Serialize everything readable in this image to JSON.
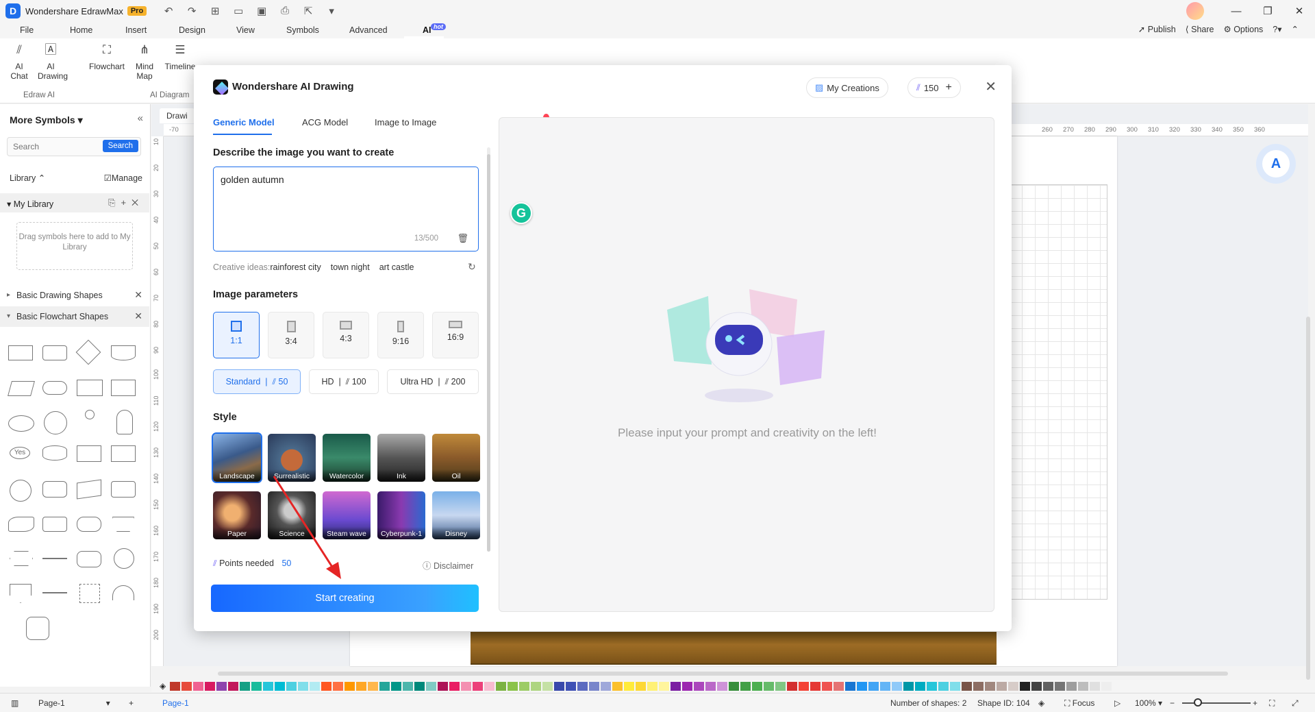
{
  "titlebar": {
    "app_title": "Wondershare EdrawMax",
    "badge": "Pro"
  },
  "menu": {
    "items": [
      "File",
      "Home",
      "Insert",
      "Design",
      "View",
      "Symbols",
      "Advanced",
      "AI"
    ],
    "hot_badge": "hot",
    "publish": "Publish",
    "share": "Share",
    "options": "Options"
  },
  "ribbon": {
    "ai_chat": "AI Chat",
    "ai_drawing": "AI Drawing",
    "flowchart": "Flowchart",
    "mind_map": "Mind Map",
    "timeline": "Timeline",
    "group_edraw_ai": "Edraw AI",
    "group_ai_diagram": "AI Diagram"
  },
  "left_panel": {
    "title": "More Symbols",
    "search_placeholder": "Search",
    "search_button": "Search",
    "library_label": "Library",
    "manage_label": "Manage",
    "my_library": "My Library",
    "drop_hint": "Drag symbols here to add to My Library",
    "categories": [
      "Basic Drawing Shapes",
      "Basic Flowchart Shapes"
    ],
    "yes_label": "Yes"
  },
  "canvas": {
    "doc_tab": "Drawi",
    "ruler_top": [
      "-70",
      "260",
      "270",
      "280",
      "290",
      "300",
      "310",
      "320",
      "330",
      "340",
      "350",
      "360"
    ],
    "ruler_left": [
      "10",
      "20",
      "30",
      "40",
      "50",
      "60",
      "70",
      "80",
      "90",
      "100",
      "110",
      "120",
      "130",
      "140",
      "150",
      "160",
      "170",
      "180",
      "190",
      "200"
    ]
  },
  "modal": {
    "title": "Wondershare AI Drawing",
    "my_creations": "My Creations",
    "points_balance": "150",
    "tabs": [
      "Generic Model",
      "ACG Model",
      "Image to Image"
    ],
    "describe_label": "Describe the image you want to create",
    "prompt_value": "golden autumn",
    "counter": "13/500",
    "ideas_label": "Creative ideas:",
    "ideas": [
      "rainforest city",
      "town night",
      "art castle"
    ],
    "params_label": "Image parameters",
    "ratios": [
      "1:1",
      "3:4",
      "4:3",
      "9:16",
      "16:9"
    ],
    "qualities": [
      {
        "name": "Standard",
        "cost": "50"
      },
      {
        "name": "HD",
        "cost": "100"
      },
      {
        "name": "Ultra HD",
        "cost": "200"
      }
    ],
    "style_label": "Style",
    "styles": [
      "Landscape",
      "Surrealistic",
      "Watercolor",
      "Ink",
      "Oil",
      "Paper",
      "Science",
      "Steam wave",
      "Cyberpunk-1",
      "Disney"
    ],
    "points_needed_label": "Points needed",
    "points_needed_value": "50",
    "disclaimer": "Disclaimer",
    "start_button": "Start creating",
    "preview_placeholder": "Please input your prompt and creativity on the left!"
  },
  "status": {
    "page_select": "Page-1",
    "page_tab": "Page-1",
    "shape_count": "Number of shapes: 2",
    "shape_id": "Shape ID: 104",
    "focus": "Focus",
    "zoom": "100%"
  },
  "palette": [
    "#c0392b",
    "#e74c3c",
    "#f06292",
    "#d81b60",
    "#8e44ad",
    "#c2185b",
    "#16a085",
    "#1abc9c",
    "#26c6da",
    "#00bcd4",
    "#4dd0e1",
    "#80deea",
    "#b2ebf2",
    "#ff5722",
    "#ff7043",
    "#ff9800",
    "#ffa726",
    "#ffb74d",
    "#26a69a",
    "#009688",
    "#4db6ac",
    "#00897b",
    "#80cbc4",
    "#ad1457",
    "#e91e63",
    "#f48fb1",
    "#ec407a",
    "#f8bbd0",
    "#7cb342",
    "#8bc34a",
    "#9ccc65",
    "#aed581",
    "#c5e1a5",
    "#3949ab",
    "#3f51b5",
    "#5c6bc0",
    "#7986cb",
    "#9fa8da",
    "#fbc02d",
    "#ffeb3b",
    "#fdd835",
    "#fff176",
    "#fff59d",
    "#7b1fa2",
    "#9c27b0",
    "#ab47bc",
    "#ba68c8",
    "#ce93d8",
    "#388e3c",
    "#43a047",
    "#4caf50",
    "#66bb6a",
    "#81c784",
    "#d32f2f",
    "#f44336",
    "#e53935",
    "#ef5350",
    "#e57373",
    "#1976d2",
    "#2196f3",
    "#42a5f5",
    "#64b5f6",
    "#90caf9",
    "#0097a7",
    "#00acc1",
    "#26c6da",
    "#4dd0e1",
    "#80deea",
    "#795548",
    "#8d6e63",
    "#a1887f",
    "#bcaaa4",
    "#d7ccc8",
    "#212121",
    "#424242",
    "#616161",
    "#757575",
    "#9e9e9e",
    "#bdbdbd",
    "#e0e0e0",
    "#eeeeee"
  ]
}
